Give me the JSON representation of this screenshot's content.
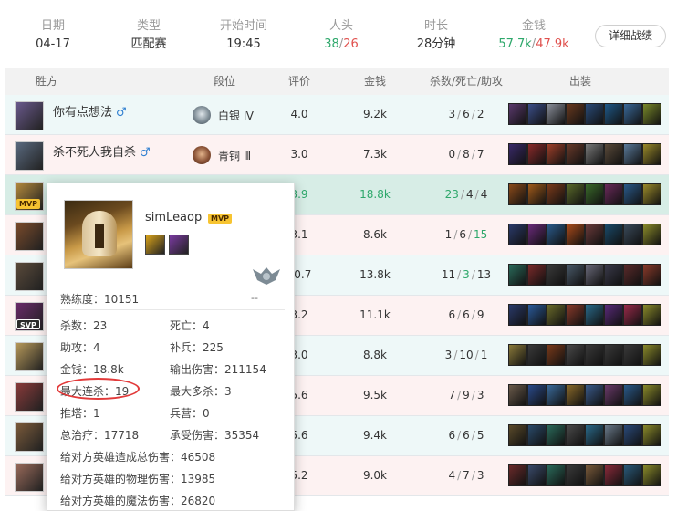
{
  "summary": {
    "date_label": "日期",
    "date": "04-17",
    "type_label": "类型",
    "type": "匹配赛",
    "start_label": "开始时间",
    "start": "19:45",
    "kills_label": "人头",
    "kills_a": "38",
    "kills_sep": "/",
    "kills_b": "26",
    "duration_label": "时长",
    "duration": "28分钟",
    "gold_label": "金钱",
    "gold_a": "57.7k",
    "gold_sep": "/",
    "gold_b": "47.9k",
    "detail_button": "详细战绩"
  },
  "table": {
    "headers": {
      "winner": "胜方",
      "rank": "段位",
      "rating": "评价",
      "gold": "金钱",
      "kda": "杀数/死亡/助攻",
      "items": "出装"
    },
    "rows": [
      {
        "name": "你有点想法",
        "male": "♂",
        "rank": "白银 Ⅳ",
        "rank_tier": "silver",
        "rating": "4.0",
        "gold": "9.2k",
        "k": "3",
        "d": "6",
        "a": "2",
        "tag": "",
        "avatar_color": "#6b5a8e",
        "items": [
          "#5b3a6e",
          "#3c4f8a",
          "#8a8f9a",
          "#6a3a1f",
          "#2a4c7a",
          "#1f5a8a",
          "#3a6a9a",
          "#7a8a2a"
        ]
      },
      {
        "name": "杀不死人我自杀",
        "male": "♂",
        "rank": "青铜 Ⅲ",
        "rank_tier": "bronze",
        "rating": "3.0",
        "gold": "7.3k",
        "k": "0",
        "d": "8",
        "a": "7",
        "tag": "",
        "avatar_color": "#5a6a80",
        "items": [
          "#3a2a6a",
          "#8a2a2a",
          "#a0402a",
          "#6a3a2a",
          "#7a7a7a",
          "#5a4a3a",
          "#5a7a9a",
          "#9a8a2a"
        ]
      },
      {
        "name": "",
        "male": "",
        "rank": "",
        "rank_tier": "",
        "rating": "3.9",
        "gold": "18.8k",
        "k": "23",
        "d": "4",
        "a": "4",
        "tag": "MVP",
        "avatar_color": "#b58a3c",
        "items": [
          "#8a4a1a",
          "#a05a1a",
          "#7a3a1a",
          "#5a6a2a",
          "#3a6a2a",
          "#6a2a5a",
          "#2a5a8a",
          "#9a8a2a"
        ]
      },
      {
        "name": "",
        "male": "",
        "rank": "",
        "rank_tier": "",
        "rating": "3.1",
        "gold": "8.6k",
        "k": "1",
        "d": "6",
        "a": "15",
        "tag": "",
        "avatar_color": "#7a4a2a",
        "items": [
          "#2a3a6a",
          "#6a2a7a",
          "#2a5a8a",
          "#aa4a1a",
          "#6a3a3a",
          "#1a4a6a",
          "#3a4a5a",
          "#8a8a2a"
        ]
      },
      {
        "name": "",
        "male": "",
        "rank": "",
        "rank_tier": "",
        "rating": "10.7",
        "gold": "13.8k",
        "k": "11",
        "d": "3",
        "a": "13",
        "tag": "",
        "avatar_color": "#5a4a3a",
        "items": [
          "#2a6a5a",
          "#7a2a2a",
          "#3a3a3a",
          "#4a5a6a",
          "#6a6a7a",
          "#3a3a4a",
          "#5a2a2a",
          "#8a3a2a"
        ]
      },
      {
        "name": "",
        "male": "",
        "rank": "",
        "rank_tier": "",
        "rating": "3.2",
        "gold": "11.1k",
        "k": "6",
        "d": "6",
        "a": "9",
        "tag": "SVP",
        "avatar_color": "#6a2a6a",
        "items": [
          "#2a3a6a",
          "#2a5a9a",
          "#6a6a2a",
          "#8a3a2a",
          "#2a6a8a",
          "#5a2a7a",
          "#9a2a4a",
          "#8a8a2a"
        ]
      },
      {
        "name": "",
        "male": "",
        "rank": "",
        "rank_tier": "",
        "rating": "3.0",
        "gold": "8.8k",
        "k": "3",
        "d": "10",
        "a": "1",
        "tag": "",
        "avatar_color": "#b89a5a",
        "items": [
          "#8a7a3a",
          "#3a3a3a",
          "#7a3a1a",
          "#4a4a4a",
          "#3a3a3a",
          "#3a3a3a",
          "#3a3a3a",
          "#8a8a2a"
        ]
      },
      {
        "name": "",
        "male": "",
        "rank": "",
        "rank_tier": "",
        "rating": "5.6",
        "gold": "9.5k",
        "k": "7",
        "d": "9",
        "a": "3",
        "tag": "",
        "avatar_color": "#8a3a3a",
        "items": [
          "#6a5a4a",
          "#2a4a8a",
          "#3a6a9a",
          "#8a6a2a",
          "#3a5a8a",
          "#6a3a6a",
          "#2a5a8a",
          "#8a8a2a"
        ]
      },
      {
        "name": "",
        "male": "",
        "rank": "",
        "rank_tier": "",
        "rating": "5.6",
        "gold": "9.4k",
        "k": "6",
        "d": "6",
        "a": "5",
        "tag": "",
        "avatar_color": "#7a5a3a",
        "items": [
          "#5a4a2a",
          "#2a4a6a",
          "#2a6a5a",
          "#4a4a4a",
          "#2a6a8a",
          "#6a7a8a",
          "#2a4a7a",
          "#8a8a2a"
        ]
      },
      {
        "name": "",
        "male": "",
        "rank": "",
        "rank_tier": "",
        "rating": "5.2",
        "gold": "9.0k",
        "k": "4",
        "d": "7",
        "a": "3",
        "tag": "",
        "avatar_color": "#9a6a5a",
        "items": [
          "#6a2a2a",
          "#3a4a6a",
          "#2a6a5a",
          "#3a3a3a",
          "#7a5a3a",
          "#8a2a3a",
          "#2a5a7a",
          "#8a8a2a"
        ]
      }
    ]
  },
  "popup": {
    "player_name": "simLeaop",
    "mvp": "MVP",
    "rank_text": "--",
    "spell_colors": [
      "#d8a21a",
      "#7a3aa0"
    ],
    "stats": {
      "mastery_label": "熟练度：",
      "mastery": "10151",
      "kills_label": "杀数：",
      "kills": "23",
      "deaths_label": "死亡：",
      "deaths": "4",
      "assists_label": "助攻：",
      "assists": "4",
      "cs_label": "补兵：",
      "cs": "225",
      "gold_label": "金钱：",
      "gold": "18.8k",
      "dmg_out_label": "输出伤害：",
      "dmg_out": "211154",
      "streak_label": "最大连杀：",
      "streak": "19",
      "multikill_label": "最大多杀：",
      "multikill": "3",
      "towers_label": "推塔：",
      "towers": "1",
      "barracks_label": "兵营：",
      "barracks": "0",
      "heal_label": "总治疗：",
      "heal": "17718",
      "dmg_taken_label": "承受伤害：",
      "dmg_taken": "35354",
      "dmg_champ_total_label": "给对方英雄造成总伤害：",
      "dmg_champ_total": "46508",
      "dmg_champ_phys_label": "给对方英雄的物理伤害：",
      "dmg_champ_phys": "13985",
      "dmg_champ_magic_label": "给对方英雄的魔法伤害：",
      "dmg_champ_magic": "26820"
    }
  },
  "colors": {
    "accent_green": "#2ea86b",
    "accent_red": "#e0504d",
    "annotation_circle": "#e23a3a",
    "row_highlight": "#d7ede6"
  }
}
